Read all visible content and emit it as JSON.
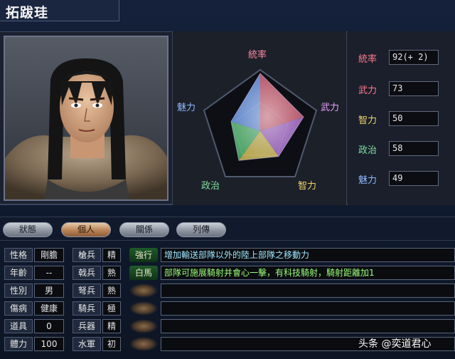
{
  "character": {
    "name": "拓跋珪"
  },
  "radar": {
    "labels": {
      "top": "統率",
      "right": "武力",
      "bottom_right": "智力",
      "bottom_left": "政治",
      "left": "魅力"
    },
    "values": {
      "統率": 92,
      "武力": 73,
      "智力": 50,
      "政治": 58,
      "魅力": 49
    },
    "max": 100
  },
  "stats": [
    {
      "label": "統率",
      "value": "92(+ 2)",
      "color": "#ff7a8e"
    },
    {
      "label": "武力",
      "value": "73",
      "color": "#ff7a8e"
    },
    {
      "label": "智力",
      "value": "50",
      "color": "#f2d36b"
    },
    {
      "label": "政治",
      "value": "58",
      "color": "#7fe0a0"
    },
    {
      "label": "魅力",
      "value": "49",
      "color": "#8fb8ff"
    }
  ],
  "tabs": [
    "狀態",
    "個人",
    "關係",
    "列傳"
  ],
  "active_tab": "個人",
  "profile": [
    {
      "label": "性格",
      "value": "剛膽"
    },
    {
      "label": "年齡",
      "value": "--"
    },
    {
      "label": "性別",
      "value": "男"
    },
    {
      "label": "傷病",
      "value": "健康"
    },
    {
      "label": "道具",
      "value": "0"
    },
    {
      "label": "體力",
      "value": "100"
    }
  ],
  "aptitudes": [
    {
      "label": "槍兵",
      "value": "精"
    },
    {
      "label": "戟兵",
      "value": "熟"
    },
    {
      "label": "弩兵",
      "value": "熟"
    },
    {
      "label": "騎兵",
      "value": "極"
    },
    {
      "label": "兵器",
      "value": "精"
    },
    {
      "label": "水軍",
      "value": "初"
    }
  ],
  "skills": [
    {
      "name": "強行",
      "desc": "增加輸送部隊以外的陸上部隊之移動力",
      "desc_color": "#9fe8ff"
    },
    {
      "name": "白馬",
      "desc": "部隊可施展騎射并會心一擊，有科技騎射，騎射距離加1",
      "desc_color": "#9cff7a"
    },
    {
      "name": "",
      "desc": ""
    },
    {
      "name": "",
      "desc": ""
    },
    {
      "name": "",
      "desc": ""
    },
    {
      "name": "",
      "desc": ""
    }
  ],
  "watermark": "头条 @奕道君心"
}
